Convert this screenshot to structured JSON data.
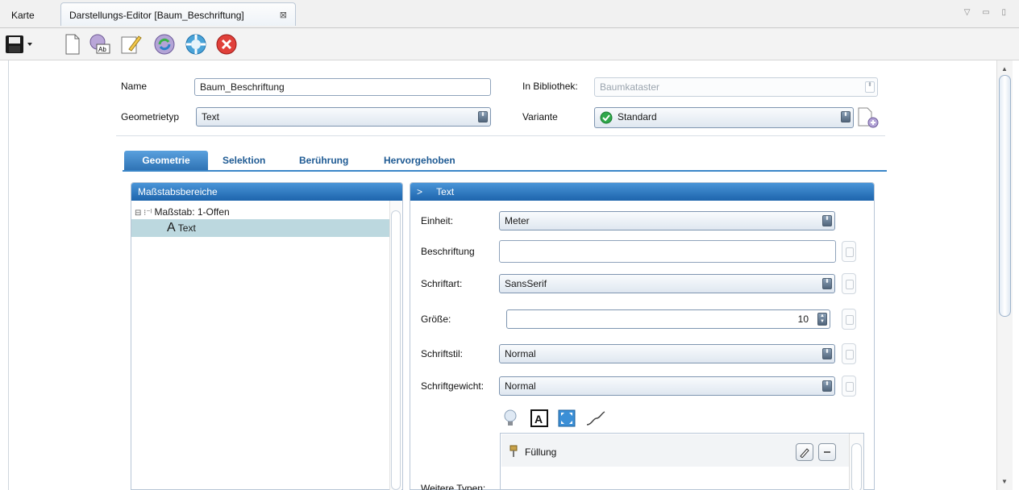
{
  "tabs": {
    "karte": "Karte",
    "editor": "Darstellungs-Editor [Baum_Beschriftung]",
    "close_glyph": "⊠",
    "window_controls": "▽ ▭ ▯"
  },
  "form": {
    "name_label": "Name",
    "name_value": "Baum_Beschriftung",
    "geomtype_label": "Geometrietyp",
    "geomtype_value": "Text",
    "library_label": "In Bibliothek:",
    "library_value": "Baumkataster",
    "variant_label": "Variante",
    "variant_value": "Standard"
  },
  "subtabs": [
    "Geometrie",
    "Selektion",
    "Berührung",
    "Hervorgehoben"
  ],
  "left_panel": {
    "title": "Maßstabsbereiche",
    "tree": [
      {
        "label": "Maßstab: 1-Offen",
        "prefix": "⊟ ⁝⁻ˡ"
      },
      {
        "label": "Text",
        "prefix": "A"
      }
    ]
  },
  "right_panel": {
    "title": "Text",
    "title_prefix": ">",
    "einheit_label": "Einheit:",
    "einheit_value": "Meter",
    "beschriftung_label": "Beschriftung",
    "beschriftung_value": "",
    "schriftart_label": "Schriftart:",
    "schriftart_value": "SansSerif",
    "groesse_label": "Größe:",
    "groesse_value": "10",
    "schriftstil_label": "Schriftstil:",
    "schriftstil_value": "Normal",
    "schriftgewicht_label": "Schriftgewicht:",
    "schriftgewicht_value": "Normal",
    "weitere_typen_label": "Weitere Typen:",
    "fuellung_label": "Füllung"
  },
  "colors": {
    "accent": "#2f73b5",
    "tab_active": "#3a86c8",
    "selection": "#bcd8df"
  },
  "icons": [
    "save-icon",
    "new-document-icon",
    "label-icon",
    "edit-icon",
    "refresh-icon",
    "apply-icon",
    "cancel-icon"
  ]
}
